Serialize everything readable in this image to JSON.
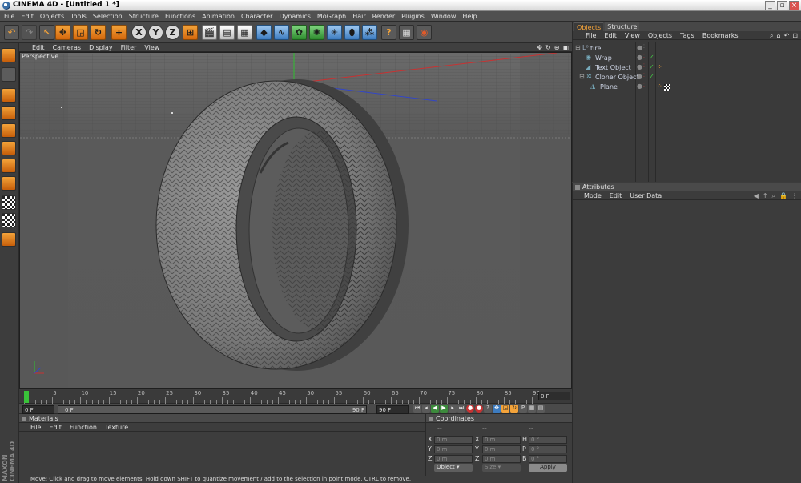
{
  "window": {
    "title": "CINEMA 4D - [Untitled 1 *]",
    "buttons": [
      "_",
      "▫",
      "×"
    ]
  },
  "menu": [
    "File",
    "Edit",
    "Objects",
    "Tools",
    "Selection",
    "Structure",
    "Functions",
    "Animation",
    "Character",
    "Dynamics",
    "MoGraph",
    "Hair",
    "Render",
    "Plugins",
    "Window",
    "Help"
  ],
  "viewport": {
    "menu": [
      "Edit",
      "Cameras",
      "Display",
      "Filter",
      "View"
    ],
    "label": "Perspective",
    "icons": [
      "✥",
      "↻",
      "⊕",
      "▣"
    ]
  },
  "timeline": {
    "ticks": [
      "0",
      "5",
      "10",
      "15",
      "20",
      "25",
      "30",
      "35",
      "40",
      "45",
      "50",
      "55",
      "60",
      "65",
      "70",
      "75",
      "80",
      "85",
      "90"
    ],
    "current_frame": "0 F",
    "start_field": "0 F",
    "range_start": "0 F",
    "range_end": "90 F",
    "end_field": "90 F"
  },
  "materials": {
    "title": "Materials",
    "menu": [
      "File",
      "Edit",
      "Function",
      "Texture"
    ]
  },
  "coordinates": {
    "title": "Coordinates",
    "headers": [
      "--",
      "--",
      "--"
    ],
    "rows": [
      {
        "a": "X",
        "av": "0 m",
        "b": "X",
        "bv": "0 m",
        "c": "H",
        "cv": "0 °"
      },
      {
        "a": "Y",
        "av": "0 m",
        "b": "Y",
        "bv": "0 m",
        "c": "P",
        "cv": "0 °"
      },
      {
        "a": "Z",
        "av": "0 m",
        "b": "Z",
        "bv": "0 m",
        "c": "B",
        "cv": "0 °"
      }
    ],
    "mode": "Object",
    "size_mode": "Size",
    "apply": "Apply"
  },
  "objects_panel": {
    "tabs": [
      "Objects",
      "Structure"
    ],
    "menu": [
      "File",
      "Edit",
      "View",
      "Objects",
      "Tags",
      "Bookmarks"
    ],
    "tree": [
      {
        "name": "tire",
        "indent": 0,
        "icon": "null"
      },
      {
        "name": "Wrap",
        "indent": 1,
        "icon": "wrap"
      },
      {
        "name": "Text Object",
        "indent": 1,
        "icon": "text"
      },
      {
        "name": "Cloner Object",
        "indent": 1,
        "icon": "cloner"
      },
      {
        "name": "Plane",
        "indent": 2,
        "icon": "plane"
      }
    ]
  },
  "attributes": {
    "title": "Attributes",
    "menu": [
      "Mode",
      "Edit",
      "User Data"
    ]
  },
  "status": "Move: Click and drag to move elements. Hold down SHIFT to quantize movement / add to the selection in point mode, CTRL to remove.",
  "brand": [
    "MAXON",
    "CINEMA 4D"
  ],
  "colors": {
    "accent": "#f3a33a",
    "viewport_bg": "#5a5a5a",
    "panel_bg": "#3c3c3c"
  }
}
